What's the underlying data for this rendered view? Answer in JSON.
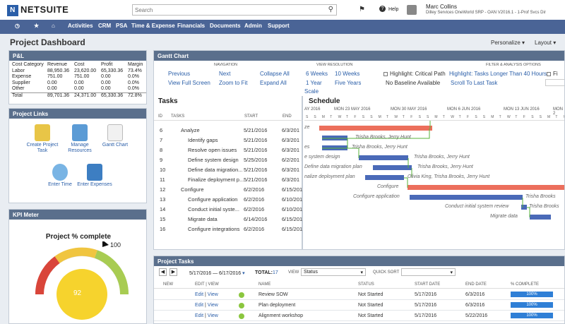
{
  "header": {
    "logo": "NETSUITE",
    "search_placeholder": "Search",
    "help": "Help",
    "user_name": "Marc Collins",
    "user_role": "Dilley Services OneWorld SRP - OAN V2016.1 - 1-Prof Svcs Dir"
  },
  "nav": [
    "Activities",
    "CRM",
    "PSA",
    "Time & Expense",
    "Financials",
    "Documents",
    "Admin",
    "Support"
  ],
  "page": {
    "title": "Project Dashboard",
    "personalize": "Personalize",
    "layout": "Layout"
  },
  "pl": {
    "title": "P&L",
    "headers": [
      "Cost Category",
      "Revenue",
      "Cost",
      "Profit",
      "Margin"
    ],
    "rows": [
      [
        "Labor",
        "88,950.36",
        "23,620.00",
        "65,330.36",
        "73.4%"
      ],
      [
        "Expense",
        "751.00",
        "751.00",
        "0.00",
        "0.0%"
      ],
      [
        "Supplier",
        "0.00",
        "0.00",
        "0.00",
        "0.0%"
      ],
      [
        "Other",
        "0.00",
        "0.00",
        "0.00",
        "0.0%"
      ],
      [
        "Total",
        "89,701.36",
        "24,371.00",
        "65,330.36",
        "72.8%"
      ]
    ]
  },
  "project_links": {
    "title": "Project Links",
    "items": [
      "Create Project Task",
      "Manage Resources",
      "Gantt Chart",
      "Enter Time",
      "Enter Expenses"
    ]
  },
  "kpi": {
    "title": "KPI Meter",
    "label": "Project % complete",
    "max": "100",
    "value": "92",
    "value_fraction": 0.92
  },
  "gantt": {
    "title": "Gantt Chart",
    "group_navigation": "NAVIGATION",
    "group_view": "VIEW RESOLUTION",
    "group_filter": "FILTER & ANALYSIS OPTIONS",
    "nav_links": [
      "Previous",
      "Next",
      "Collapse All",
      "View Full Screen",
      "Zoom to Fit",
      "Expand All"
    ],
    "view_links": [
      "6 Weeks",
      "10 Weeks",
      "1 Year",
      "Five Years",
      "Scale"
    ],
    "filter_options": [
      "Highlight: Critical Path",
      "Highlight: Tasks Longer Than 40 Hours",
      "No Baseline Available",
      "Scroll To Last Task",
      "Fi"
    ],
    "tasks_header": "Tasks",
    "schedule_header": "Schedule",
    "cols": [
      "ID",
      "TASKS",
      "START",
      "END"
    ],
    "tasks": [
      {
        "id": "6",
        "name": "Analyze",
        "start": "5/21/2016",
        "end": "6/3/201"
      },
      {
        "id": "7",
        "name": "Identify gaps",
        "start": "5/21/2016",
        "end": "6/3/201"
      },
      {
        "id": "8",
        "name": "Resolve open issues",
        "start": "5/21/2016",
        "end": "6/3/201"
      },
      {
        "id": "9",
        "name": "Define system design",
        "start": "5/25/2016",
        "end": "6/2/201"
      },
      {
        "id": "10",
        "name": "Define data migration...",
        "start": "5/21/2016",
        "end": "6/3/201"
      },
      {
        "id": "11",
        "name": "Finalize deployment p...",
        "start": "5/21/2016",
        "end": "6/3/201"
      },
      {
        "id": "12",
        "name": "Configure",
        "start": "6/2/2016",
        "end": "6/15/201"
      },
      {
        "id": "13",
        "name": "Configure application",
        "start": "6/2/2016",
        "end": "6/10/201"
      },
      {
        "id": "14",
        "name": "Conduct initial syste...",
        "start": "6/2/2016",
        "end": "6/10/201"
      },
      {
        "id": "15",
        "name": "Migrate data",
        "start": "6/14/2016",
        "end": "6/15/201"
      },
      {
        "id": "16",
        "name": "Configure integrations",
        "start": "6/2/2016",
        "end": "6/15/201"
      }
    ],
    "timeline_months": [
      "AY 2016",
      "MON 23 MAY 2016",
      "MON 30 MAY 2016",
      "MON 6 JUN 2016",
      "MON 13 JUN 2016",
      "MON 2"
    ],
    "bar_labels": [
      "ze",
      "Trisha Brooks, Jerry Hunt",
      "es",
      "Trisha Brooks, Jerry Hunt",
      "e system design",
      "Trisha Brooks, Jerry Hunt",
      "Define data migration plan",
      "Trisha Brooks, Jerry Hunt",
      "nalize deployment plan",
      "Olivia King, Trisha Brooks, Jerry Hunt",
      "Configure",
      "Configure application",
      "Trisha Brooks",
      "Conduct initial system review",
      "Trisha Brooks",
      "Migrate data"
    ]
  },
  "project_tasks": {
    "title": "Project Tasks",
    "date_range": "5/17/2016 — 6/17/2016",
    "total_label": "TOTAL:",
    "total_value": "17",
    "view_label": "VIEW",
    "view_value": "Status",
    "quick_sort_label": "QUICK SORT",
    "columns": [
      "NEW",
      "EDIT | VIEW",
      "NAME",
      "STATUS",
      "START DATE",
      "END DATE",
      "% COMPLETE"
    ],
    "edit": "Edit",
    "view": "View",
    "rows": [
      {
        "name": "Review SOW",
        "status": "Not Started",
        "start": "5/17/2016",
        "end": "6/3/2016",
        "pct": "100%"
      },
      {
        "name": "Plan deployment",
        "status": "Not Started",
        "start": "5/17/2016",
        "end": "6/3/2016",
        "pct": "100%"
      },
      {
        "name": "Alignment workshop",
        "status": "Not Started",
        "start": "5/17/2016",
        "end": "5/22/2016",
        "pct": "100%"
      }
    ]
  },
  "colors": {
    "nav": "#4a6496",
    "portlet_header": "#5a6f8c",
    "bar_blue": "#4a6ab8",
    "bar_red": "#ec6f5c",
    "progress": "#2f7fd6"
  }
}
